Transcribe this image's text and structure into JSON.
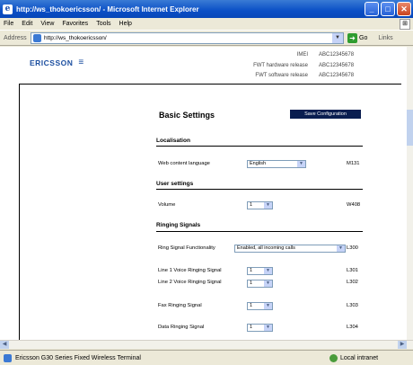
{
  "window": {
    "title": "http://ws_thokoericsson/ - Microsoft Internet Explorer"
  },
  "menu": [
    "File",
    "Edit",
    "View",
    "Favorites",
    "Tools",
    "Help"
  ],
  "address": {
    "label": "Address",
    "url": "http://ws_thokoericsson/",
    "go_label": "Go",
    "links_label": "Links"
  },
  "page": {
    "logo_text": "ERICSSON",
    "info": [
      {
        "label": "IMEI",
        "value": "ABC12345678"
      },
      {
        "label": "FWT hardware release",
        "value": "ABC12345678"
      },
      {
        "label": "FWT software release",
        "value": "ABC12345678"
      }
    ],
    "title": "Basic Settings",
    "save_button": "Save Configuration",
    "sections": {
      "localisation": {
        "title": "Localisation",
        "rows": [
          {
            "label": "Web content language",
            "value": "English",
            "code": "M131"
          }
        ]
      },
      "user_settings": {
        "title": "User settings",
        "rows": [
          {
            "label": "Volume",
            "value": "1",
            "code": "W408"
          }
        ]
      },
      "ringing": {
        "title": "Ringing Signals",
        "rows": [
          {
            "label": "Ring Signal Functionality",
            "value": "Enabled, all incoming calls",
            "code": "L300"
          },
          {
            "label": "Line 1 Voice Ringing Signal",
            "value": "1",
            "code": "L301"
          },
          {
            "label": "Line 2 Voice Ringing Signal",
            "value": "1",
            "code": "L302"
          },
          {
            "label": "Fax Ringing Signal",
            "value": "1",
            "code": "L303"
          },
          {
            "label": "Data Ringing Signal",
            "value": "1",
            "code": "L304"
          }
        ]
      }
    }
  },
  "status": {
    "text": "Ericsson G30 Series Fixed Wireless Terminal",
    "zone": "Local intranet"
  }
}
